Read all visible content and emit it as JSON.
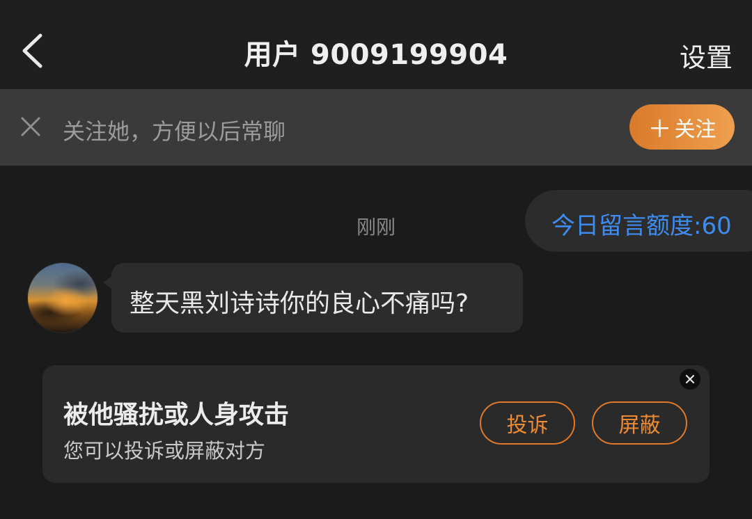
{
  "header": {
    "title": "用户 9009199904",
    "settings_label": "设置"
  },
  "follow_banner": {
    "text": "关注她，方便以后常聊",
    "button_label": "关注",
    "accent_color": "#E8892F"
  },
  "chat": {
    "timestamp": "刚刚",
    "quota_label": "今日留言额度:60",
    "quota_color": "#3F8CF0",
    "messages": [
      {
        "sender": "other",
        "text": "整天黑刘诗诗你的良心不痛吗?"
      }
    ]
  },
  "report_card": {
    "title": "被他骚扰或人身攻击",
    "subtitle": "您可以投诉或屏蔽对方",
    "report_button": "投诉",
    "block_button": "屏蔽"
  },
  "icons": [
    "back-arrow-icon",
    "close-icon",
    "plus-icon",
    "avatar-image",
    "close-circle-icon"
  ]
}
